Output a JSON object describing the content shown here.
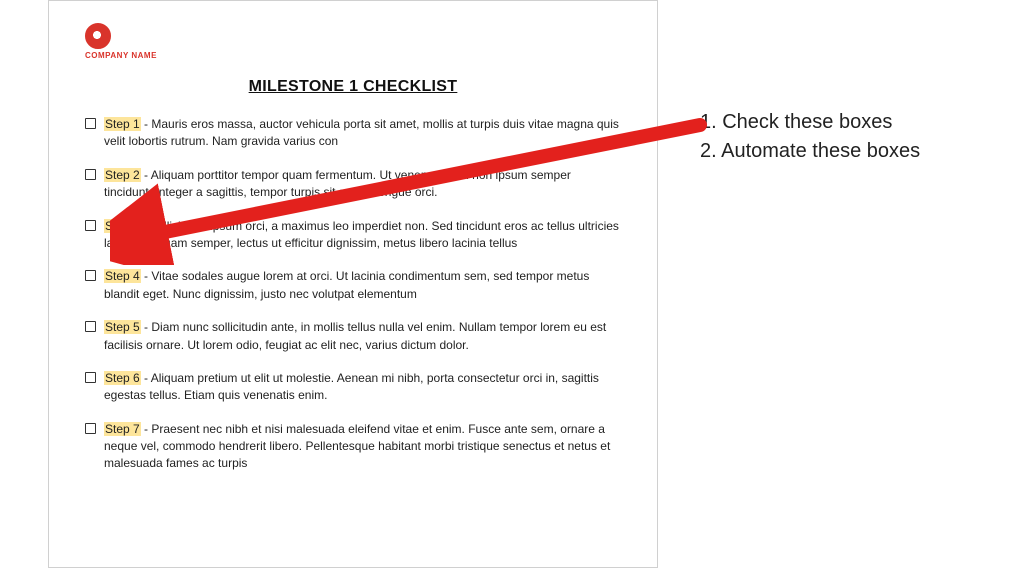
{
  "company_name": "COMPANY NAME",
  "title": "MILESTONE 1 CHECKLIST",
  "steps": [
    {
      "label": "Step 1",
      "text": " - Mauris eros massa, auctor vehicula porta sit amet, mollis at turpis duis vitae magna quis velit lobortis rutrum. Nam gravida varius con"
    },
    {
      "label": "Step 2",
      "text": " - Aliquam porttitor tempor quam fermentum. Ut venenatis orci non ipsum semper tincidunt. Integer a sagittis, tempor turpis sit amet, congue orci."
    },
    {
      "label": "Step 3",
      "text": " - sollicitudin ipsum orci, a maximus leo imperdiet non. Sed tincidunt eros ac tellus ultricies lacinia. Aliquam semper, lectus ut efficitur dignissim, metus libero lacinia tellus"
    },
    {
      "label": "Step 4",
      "text": " - Vitae sodales augue lorem at orci. Ut lacinia condimentum sem, sed tempor metus blandit eget. Nunc dignissim, justo nec volutpat elementum"
    },
    {
      "label": "Step 5",
      "text": " - Diam nunc sollicitudin ante, in mollis tellus nulla vel enim. Nullam tempor lorem eu est facilisis ornare. Ut lorem odio, feugiat ac elit nec, varius dictum dolor."
    },
    {
      "label": "Step 6",
      "text": " - Aliquam pretium ut elit ut molestie. Aenean mi nibh, porta consectetur orci in, sagittis egestas tellus. Etiam quis venenatis enim."
    },
    {
      "label": "Step 7",
      "text": " - Praesent nec nibh et nisi malesuada eleifend vitae et enim. Fusce ante sem, ornare a neque vel, commodo hendrerit libero. Pellentesque habitant morbi tristique senectus et netus et malesuada fames ac turpis"
    }
  ],
  "annotations": {
    "line1": "1. Check these boxes",
    "line2": "2. Automate these boxes"
  },
  "colors": {
    "brand_red": "#d9342b",
    "highlight": "#fde59b",
    "arrow": "#e3211d"
  }
}
